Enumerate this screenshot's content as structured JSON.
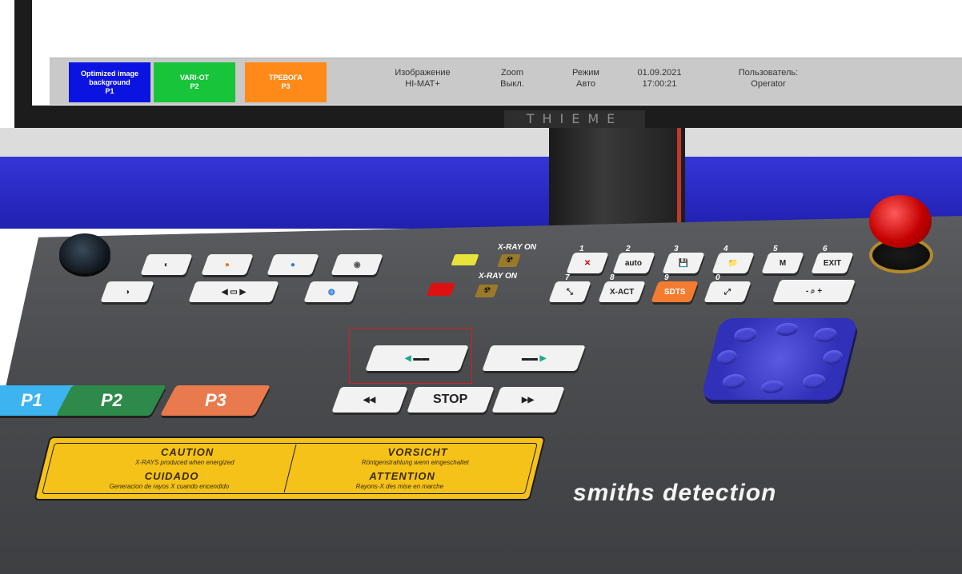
{
  "monitor": {
    "presets": [
      {
        "line1": "Optimized image",
        "line2": "background",
        "line3": "P1",
        "color": "#0b13e0"
      },
      {
        "line1": "VARI-OT",
        "line2": "P2",
        "color": "#17c43a"
      },
      {
        "line1": "ТРЕВОГА",
        "line2": "P3",
        "color": "#ff8a1a"
      }
    ],
    "fields": {
      "image_label": "Изображение",
      "image_value": "HI-MAT+",
      "zoom_label": "Zoom",
      "zoom_value": "Выкл.",
      "mode_label": "Режим",
      "mode_value": "Авто",
      "date": "01.09.2021",
      "time": "17:00:21",
      "user_label": "Пользователь:",
      "user_value": "Operator"
    },
    "bezel_logo": "THIEME"
  },
  "console": {
    "xray_on": "X-RAY ON",
    "key_stop": "STOP",
    "key_auto": "auto",
    "key_exit": "EXIT",
    "key_sdts": "SDTS",
    "key_xact": "X-ACT",
    "key_m": "M",
    "key_zoom": "- ⌕ +",
    "num1": "1",
    "num2": "2",
    "num3": "3",
    "num4": "4",
    "num5": "5",
    "num6": "6",
    "num7": "7",
    "num8": "8",
    "num9": "9",
    "num0": "0",
    "preset_keys": [
      "P1",
      "P2",
      "P3"
    ],
    "brand": "smiths detection"
  },
  "caution_label": {
    "en_title": "CAUTION",
    "en_text": "X-RAYS produced when energized",
    "es_title": "CUIDADO",
    "es_text": "Generacion de rayos X cuando encendido",
    "de_title": "VORSICHT",
    "de_text": "Röntgenstrahlung wenn eingeschaltet",
    "fr_title": "ATTENTION",
    "fr_text": "Rayons-X des mise en marche"
  }
}
